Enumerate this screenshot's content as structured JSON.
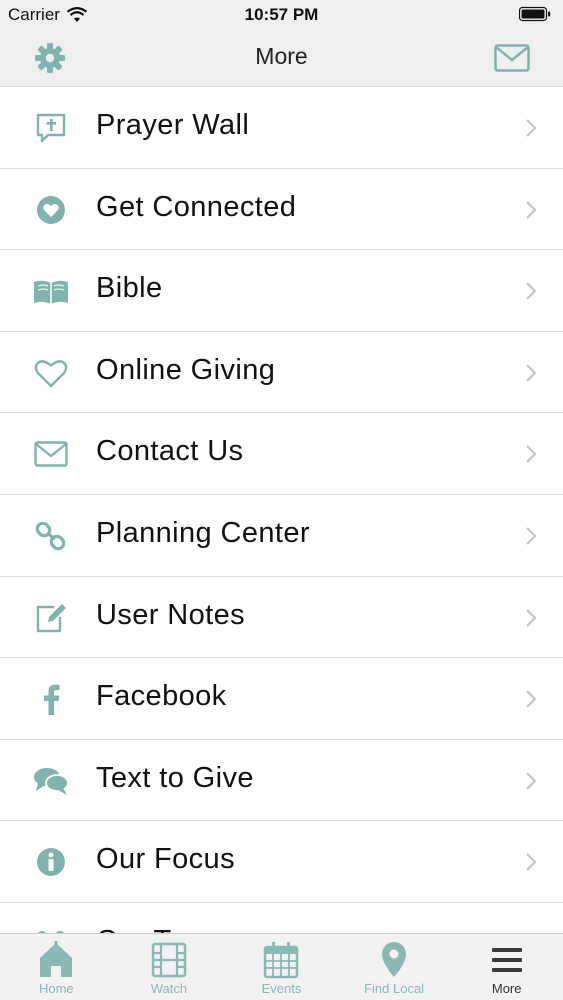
{
  "status_bar": {
    "carrier": "Carrier",
    "time": "10:57 PM"
  },
  "nav": {
    "title": "More"
  },
  "colors": {
    "accent": "#7fb3ae",
    "tab_active": "#3a3a3a"
  },
  "menu": [
    {
      "label": "Prayer Wall",
      "icon": "prayer-icon"
    },
    {
      "label": "Get Connected",
      "icon": "heart-circle-icon"
    },
    {
      "label": "Bible",
      "icon": "book-icon"
    },
    {
      "label": "Online Giving",
      "icon": "heart-outline-icon"
    },
    {
      "label": "Contact Us",
      "icon": "envelope-icon"
    },
    {
      "label": "Planning Center",
      "icon": "link-icon"
    },
    {
      "label": "User Notes",
      "icon": "edit-icon"
    },
    {
      "label": "Facebook",
      "icon": "facebook-icon"
    },
    {
      "label": "Text to Give",
      "icon": "chat-bubbles-icon"
    },
    {
      "label": "Our Focus",
      "icon": "info-icon"
    },
    {
      "label": "Our T",
      "icon": "people-icon"
    }
  ],
  "tabs": [
    {
      "label": "Home",
      "icon": "home-icon",
      "active": false
    },
    {
      "label": "Watch",
      "icon": "film-icon",
      "active": false
    },
    {
      "label": "Events",
      "icon": "calendar-icon",
      "active": false
    },
    {
      "label": "Find Local",
      "icon": "map-pin-icon",
      "active": false
    },
    {
      "label": "More",
      "icon": "menu-icon",
      "active": true
    }
  ]
}
